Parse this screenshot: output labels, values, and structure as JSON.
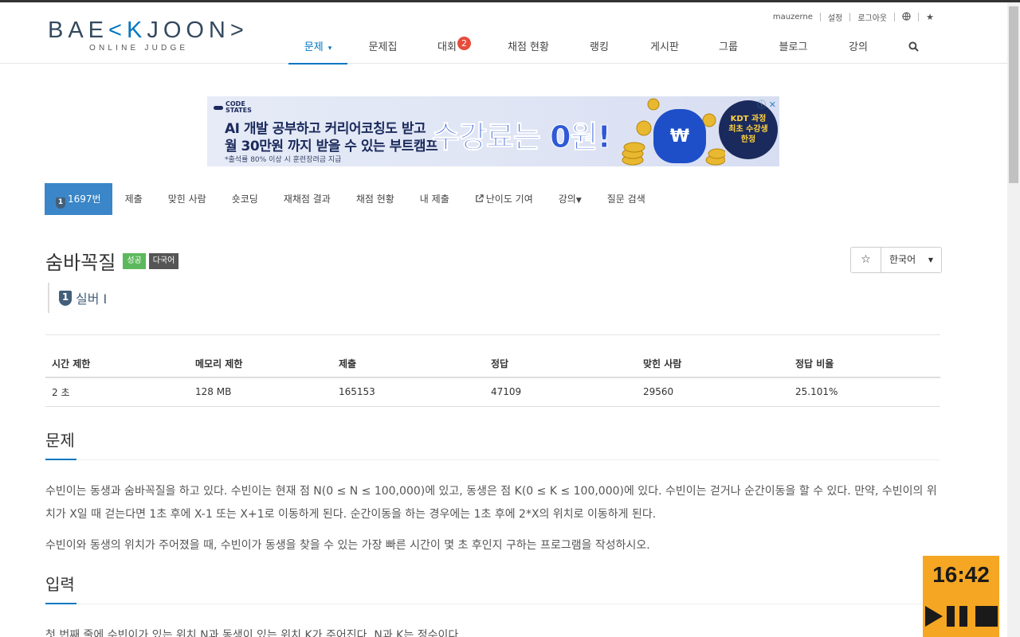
{
  "header": {
    "logo_main_a": "BAE",
    "logo_main_k": "<K",
    "logo_main_b": "JOON>",
    "logo_sub": "ONLINE JUDGE",
    "top_links": [
      "mauzerne",
      "설정",
      "로그아웃"
    ],
    "nav": [
      {
        "label": "문제",
        "active": true
      },
      {
        "label": "문제집"
      },
      {
        "label": "대회",
        "badge": "2"
      },
      {
        "label": "채점 현황"
      },
      {
        "label": "랭킹"
      },
      {
        "label": "게시판"
      },
      {
        "label": "그룹"
      },
      {
        "label": "블로그"
      },
      {
        "label": "강의"
      }
    ]
  },
  "ad": {
    "brand_top": "CODE",
    "brand_bottom": "STATES",
    "line1": "AI 개발 공부하고 커리어코칭도 받고",
    "line2": "월 30만원 까지 받을 수 있는 부트캠프",
    "note": "*출석률 80% 이상 시 훈련장려금 지급",
    "headline": "수강료는 0원!",
    "bag_symbol": "₩",
    "circle_l1": "KDT 과정",
    "circle_l2": "최초 수강생",
    "circle_l3": "한정"
  },
  "problem_menu": [
    "1697번",
    "제출",
    "맞힌 사람",
    "숏코딩",
    "재채점 결과",
    "채점 현황",
    "내 제출",
    "난이도 기여",
    "강의",
    "질문 검색"
  ],
  "problem": {
    "title": "숨바꼭질",
    "label_success": "성공",
    "label_multi": "다국어",
    "tier": "실버 I",
    "tier_num": "1",
    "lang": "한국어"
  },
  "info_table": {
    "headers": [
      "시간 제한",
      "메모리 제한",
      "제출",
      "정답",
      "맞힌 사람",
      "정답 비율"
    ],
    "row": [
      "2 초",
      "128 MB",
      "165153",
      "47109",
      "29560",
      "25.101%"
    ]
  },
  "sections": {
    "problem_heading": "문제",
    "problem_p1": "수빈이는 동생과 숨바꼭질을 하고 있다. 수빈이는 현재 점 N(0 ≤ N ≤ 100,000)에 있고, 동생은 점 K(0 ≤ K ≤ 100,000)에 있다. 수빈이는 걷거나 순간이동을 할 수 있다. 만약, 수빈이의 위치가 X일 때 걷는다면 1초 후에 X-1 또는 X+1로 이동하게 된다. 순간이동을 하는 경우에는 1초 후에 2*X의 위치로 이동하게 된다.",
    "problem_p2": "수빈이와 동생의 위치가 주어졌을 때, 수빈이가 동생을 찾을 수 있는 가장 빠른 시간이 몇 초 후인지 구하는 프로그램을 작성하시오.",
    "input_heading": "입력",
    "input_p1": "첫 번째 줄에 수빈이가 있는 위치 N과 동생이 있는 위치 K가 주어진다. N과 K는 정수이다."
  },
  "timer": {
    "time": "16:42"
  },
  "colors": {
    "accent": "#0076c0",
    "success": "#5cb85c",
    "badge": "#e74c3c",
    "timer_bg": "#f5a623"
  }
}
